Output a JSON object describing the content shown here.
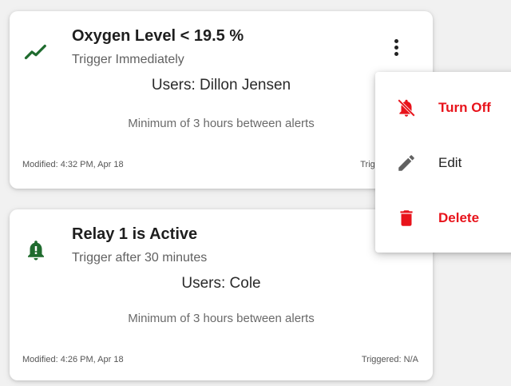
{
  "alerts": [
    {
      "title": "Oxygen Level < 19.5 %",
      "trigger": "Trigger Immediately",
      "users": "Users: Dillon Jensen",
      "minimum": "Minimum of 3 hours between alerts",
      "modified": "Modified: 4:32 PM, Apr 18",
      "triggered": "Trigge",
      "icon": "trending-up-icon"
    },
    {
      "title": "Relay 1 is Active",
      "trigger": "Trigger after 30 minutes",
      "users": "Users: Cole",
      "minimum": "Minimum of 3 hours between alerts",
      "modified": "Modified: 4:26 PM, Apr 18",
      "triggered": "Triggered: N/A",
      "icon": "bell-icon"
    }
  ],
  "menu": {
    "turn_off": "Turn Off",
    "edit": "Edit",
    "delete": "Delete"
  },
  "colors": {
    "green": "#1f6b2e",
    "red": "#e8131b",
    "gray_icon": "#616161"
  }
}
